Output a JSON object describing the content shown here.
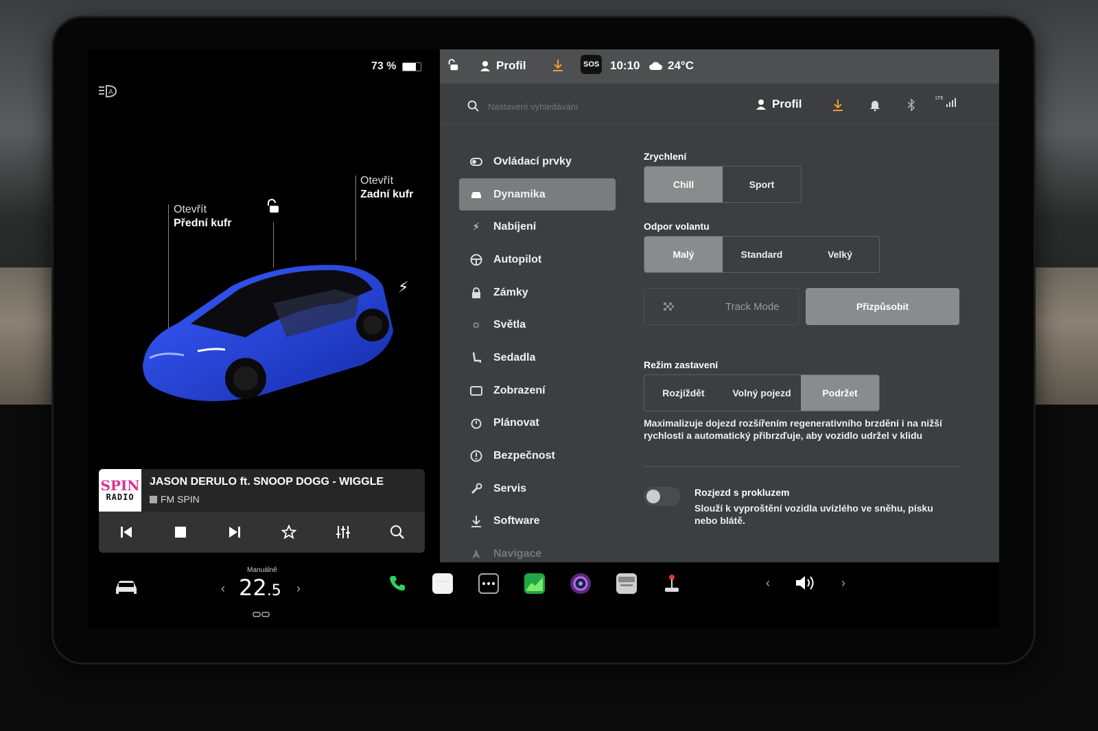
{
  "status": {
    "battery_percent": "73 %",
    "battery_level": 0.73,
    "profile_label": "Profil",
    "time": "10:10",
    "temperature": "24°C",
    "sos_label": "SOS"
  },
  "car": {
    "front_trunk_open": "Otevřít",
    "front_trunk_label": "Přední kufr",
    "rear_trunk_open": "Otevřít",
    "rear_trunk_label": "Zadní kufr",
    "paint_color": "#1f3fd6"
  },
  "media": {
    "logo_line1": "SPIN",
    "logo_line2": "RADIO",
    "title": "JASON DERULO ft. SNOOP DOGG - WIGGLE",
    "station": "FM SPIN"
  },
  "search": {
    "placeholder": "Nastavení vyhledávání",
    "profile_label": "Profil",
    "lte_label": "LTE"
  },
  "nav": {
    "items": [
      {
        "label": "Ovládací prvky",
        "icon": "toggle-icon"
      },
      {
        "label": "Dynamika",
        "icon": "car-icon"
      },
      {
        "label": "Nabíjení",
        "icon": "bolt-icon"
      },
      {
        "label": "Autopilot",
        "icon": "steering-wheel-icon"
      },
      {
        "label": "Zámky",
        "icon": "lock-icon"
      },
      {
        "label": "Světla",
        "icon": "sun-icon"
      },
      {
        "label": "Sedadla",
        "icon": "seat-icon"
      },
      {
        "label": "Zobrazení",
        "icon": "display-icon"
      },
      {
        "label": "Plánovat",
        "icon": "alarm-clock-icon"
      },
      {
        "label": "Bezpečnost",
        "icon": "alert-circle-icon"
      },
      {
        "label": "Servis",
        "icon": "wrench-icon"
      },
      {
        "label": "Software",
        "icon": "download-icon"
      },
      {
        "label": "Navigace",
        "icon": "navigation-icon"
      }
    ]
  },
  "settings": {
    "acceleration": {
      "title": "Zrychlení",
      "options": [
        "Chill",
        "Sport"
      ]
    },
    "steering": {
      "title": "Odpor volantu",
      "options": [
        "Malý",
        "Standard",
        "Velký"
      ]
    },
    "track_mode_label": "Track Mode",
    "customize_label": "Přizpůsobit",
    "stopping": {
      "title": "Režim zastavení",
      "options": [
        "Rozjíždět",
        "Volný pojezd",
        "Podržet"
      ],
      "description": "Maximalizuje dojezd rozšířením regenerativního brzdění i na nižší rychlosti a automatický přibrzďuje, aby vozidlo udržel v klidu"
    },
    "slip_start": {
      "title": "Rozjezd s prokluzem",
      "description": "Slouží k vyproštění vozidla uvízlého ve sněhu, písku nebo blátě."
    }
  },
  "dock": {
    "climate_mode": "Manuálně",
    "temp_whole": "22",
    "temp_decimal": ".5"
  },
  "colors": {
    "panel_bg": "#3d3e40",
    "selected_bg": "#8a8b8d",
    "download_accent": "#f0a030"
  }
}
